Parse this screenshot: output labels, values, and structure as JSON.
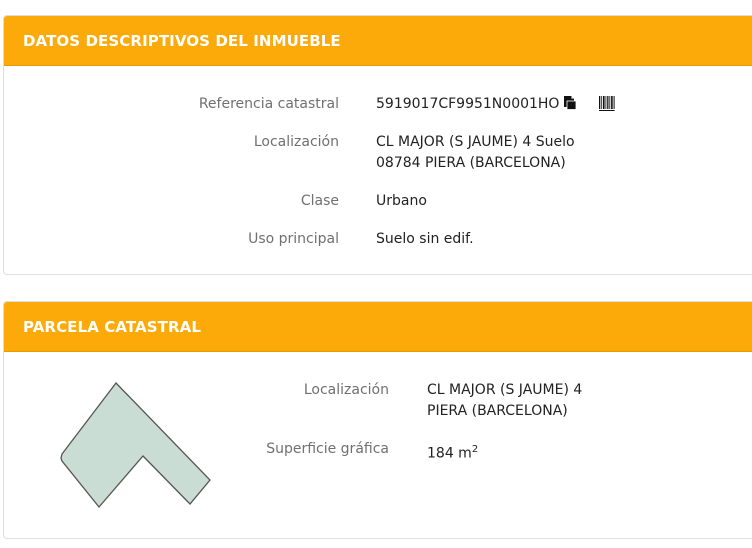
{
  "section1": {
    "title": "DATOS DESCRIPTIVOS DEL INMUEBLE",
    "fields": [
      {
        "label": "Referencia catastral",
        "value": "5919017CF9951N0001HO"
      },
      {
        "label": "Localización",
        "value_line1": "CL MAJOR (S JAUME) 4 Suelo",
        "value_line2": "08784 PIERA (BARCELONA)"
      },
      {
        "label": "Clase",
        "value": "Urbano"
      },
      {
        "label": "Uso principal",
        "value": "Suelo sin edif."
      }
    ],
    "icons": [
      "copy-icon",
      "barcode-icon"
    ]
  },
  "section2": {
    "title": "PARCELA CATASTRAL",
    "fields": [
      {
        "label": "Localización",
        "value_line1": "CL MAJOR (S JAUME) 4",
        "value_line2": "PIERA (BARCELONA)"
      },
      {
        "label": "Superficie gráfica",
        "value": "184 m",
        "unit_sup": "2"
      }
    ],
    "parcel_fill": "#c9ddd4",
    "parcel_stroke": "#555555"
  },
  "colors": {
    "header": "#fbaa09",
    "label": "#707070",
    "value": "#222222"
  }
}
